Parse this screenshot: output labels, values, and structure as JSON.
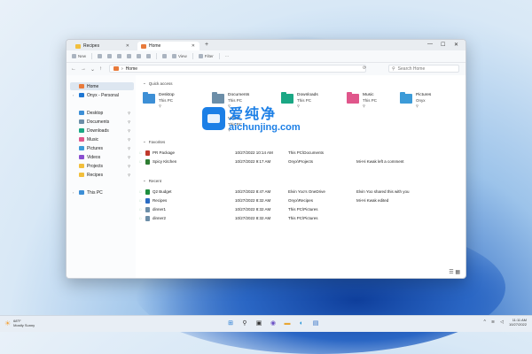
{
  "window": {
    "tabs": [
      {
        "label": "Recipes",
        "icon": "folder-icon"
      },
      {
        "label": "Home",
        "icon": "home-icon"
      }
    ],
    "new_tab_label": "+",
    "controls": [
      "—",
      "☐",
      "✕"
    ]
  },
  "toolbar": {
    "new_label": "New",
    "view_label": "View",
    "filter_label": "Filter",
    "more_label": "···"
  },
  "address": {
    "path": "Home",
    "search_placeholder": "Search Home"
  },
  "sidebar": {
    "items": [
      {
        "label": "Home",
        "icon": "home-icon",
        "color": "#e87a3b"
      },
      {
        "label": "Onyx - Personal",
        "icon": "cloud-icon",
        "color": "#1e76d2"
      },
      {
        "label": "Desktop",
        "icon": "desktop-icon",
        "color": "#3d8fd6"
      },
      {
        "label": "Documents",
        "icon": "documents-icon",
        "color": "#6c8ea8"
      },
      {
        "label": "Downloads",
        "icon": "downloads-icon",
        "color": "#1aa784"
      },
      {
        "label": "Music",
        "icon": "music-icon",
        "color": "#e0568b"
      },
      {
        "label": "Pictures",
        "icon": "pictures-icon",
        "color": "#3c9bd8"
      },
      {
        "label": "Videos",
        "icon": "videos-icon",
        "color": "#8a4fd0"
      },
      {
        "label": "Projects",
        "icon": "folder-icon",
        "color": "#f2bf3c"
      },
      {
        "label": "Recipes",
        "icon": "folder-icon",
        "color": "#f2bf3c"
      },
      {
        "label": "This PC",
        "icon": "pc-icon",
        "color": "#3d8fd6"
      }
    ]
  },
  "main": {
    "quick_access_title": "Quick access",
    "quick_access": [
      {
        "name": "Desktop",
        "location": "This PC",
        "color": "#3d8fd6"
      },
      {
        "name": "Documents",
        "location": "This PC",
        "color": "#6c8ea8"
      },
      {
        "name": "Downloads",
        "location": "This PC",
        "color": "#1aa784"
      },
      {
        "name": "Music",
        "location": "This PC",
        "color": "#e0568b"
      },
      {
        "name": "Pictures",
        "location": "Onyx",
        "color": "#3c9bd8"
      },
      {
        "name": "Videos",
        "location": "This PC",
        "color": "#8a4fd0"
      }
    ],
    "favorites_title": "Favorites",
    "favorites": [
      {
        "name": "PR Package",
        "date": "10/27/2022 10:14 AM",
        "location": "This PC\\Documents",
        "activity": "",
        "icon_color": "#c0392b"
      },
      {
        "name": "Spicy Kitchen",
        "date": "10/27/2022 9:17 AM",
        "location": "Onyx\\Projects",
        "activity": "Mi-Hi Kwak left a comment",
        "icon_color": "#2e7d32"
      }
    ],
    "recent_title": "Recent",
    "recent": [
      {
        "name": "Q2 Budget",
        "date": "10/27/2022 8:47 AM",
        "location": "Elvin Yoo's OneDrive",
        "activity": "Elvin Yoo shared this with you",
        "icon_color": "#1e8e3e"
      },
      {
        "name": "Recipes",
        "date": "10/27/2022 8:32 AM",
        "location": "Onyx\\Recipes",
        "activity": "Mi-Hi Kwak edited",
        "icon_color": "#2b6cc4"
      },
      {
        "name": "dinner1",
        "date": "10/27/2022 8:32 AM",
        "location": "This PC\\Pictures",
        "activity": "",
        "icon_color": "#6c8ea8"
      },
      {
        "name": "dinner2",
        "date": "10/27/2022 8:32 AM",
        "location": "This PC\\Pictures",
        "activity": "",
        "icon_color": "#6c8ea8"
      }
    ]
  },
  "watermark": {
    "chinese": "爱纯净",
    "site": "aichunjing.com"
  },
  "taskbar": {
    "temperature": "68°F",
    "weather": "Mostly Sunny",
    "time": "11:11 AM",
    "date": "10/27/2022"
  }
}
